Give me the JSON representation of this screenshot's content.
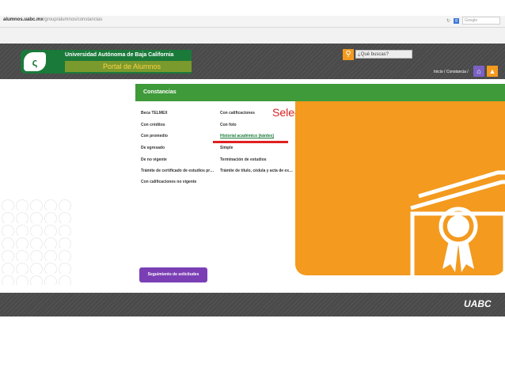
{
  "browser": {
    "url_domain": "alumnos.uabc.mx",
    "url_path": "/group/alumnos/constancias",
    "search_engine": "Google"
  },
  "header": {
    "university": "Universidad Autónoma de Baja California",
    "portal": "Portal de Alumnos",
    "search_placeholder": "¿Qué buscas?",
    "breadcrumb": "Inicio / Constancia /"
  },
  "section": {
    "title": "Constancias"
  },
  "links_left": [
    "Beca TELMEX",
    "Con créditos",
    "Con promedio",
    "De egresado",
    "De no vigente",
    "Trámite de certificado de estudios pr…",
    "Con calificaciones no vigente"
  ],
  "links_right": [
    "Con calificaciones",
    "Con foto",
    "Historial académico (kárdex)",
    "Simple",
    "Terminación de estudios",
    "Trámite de título, cédula y acta de ex…"
  ],
  "annotation": "Seleccionar",
  "buttons": {
    "tracking": "Seguimiento de solicitudes"
  },
  "footer": {
    "logo": "UABC"
  },
  "colors": {
    "green": "#3f9a3a",
    "orange": "#f39a1f",
    "purple": "#7b3fb5",
    "annotation_red": "#d8201f"
  }
}
